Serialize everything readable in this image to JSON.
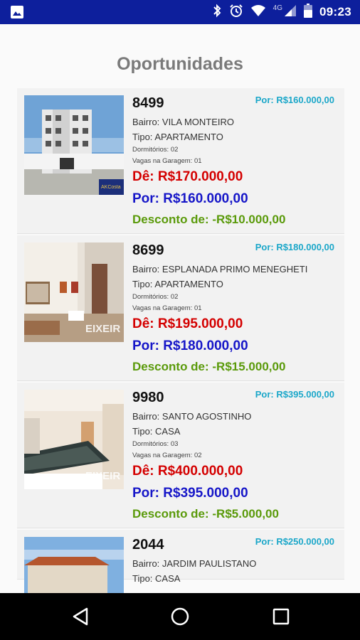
{
  "status_bar": {
    "time": "09:23",
    "network": "4G",
    "icons": [
      "image-icon",
      "bluetooth-icon",
      "alarm-icon",
      "wifi-icon",
      "signal-icon",
      "battery-icon"
    ]
  },
  "page": {
    "title": "Oportunidades"
  },
  "listings": [
    {
      "code": "8499",
      "price_top": "Por: R$160.000,00",
      "bairro": "Bairro: VILA MONTEIRO",
      "tipo": "Tipo: APARTAMENTO",
      "dormitorios": "Dormitórios: 02",
      "vagas": "Vagas na Garagem: 01",
      "de": "Dê: R$170.000,00",
      "por": "Por: R$160.000,00",
      "desconto": "Desconto de: -R$10.000,00",
      "photo": "apartment-building-photo"
    },
    {
      "code": "8699",
      "price_top": "Por: R$180.000,00",
      "bairro": "Bairro: ESPLANADA PRIMO MENEGHETI",
      "tipo": "Tipo: APARTAMENTO",
      "dormitorios": "Dormitórios: 02",
      "vagas": "Vagas na Garagem: 01",
      "de": "Dê: R$195.000,00",
      "por": "Por: R$180.000,00",
      "desconto": "Desconto de: -R$15.000,00",
      "photo": "living-room-photo"
    },
    {
      "code": "9980",
      "price_top": "Por: R$395.000,00",
      "bairro": "Bairro: SANTO AGOSTINHO",
      "tipo": "Tipo: CASA",
      "dormitorios": "Dormitórios: 03",
      "vagas": "Vagas na Garagem: 02",
      "de": "Dê: R$400.000,00",
      "por": "Por: R$395.000,00",
      "desconto": "Desconto de: -R$5.000,00",
      "photo": "kitchen-photo"
    },
    {
      "code": "2044",
      "price_top": "Por: R$250.000,00",
      "bairro": "Bairro: JARDIM PAULISTANO",
      "tipo": "Tipo: CASA",
      "photo": "house-exterior-photo"
    }
  ],
  "watermark": {
    "brand_1": "AKCosta",
    "brand_2": "EIXEIR"
  }
}
